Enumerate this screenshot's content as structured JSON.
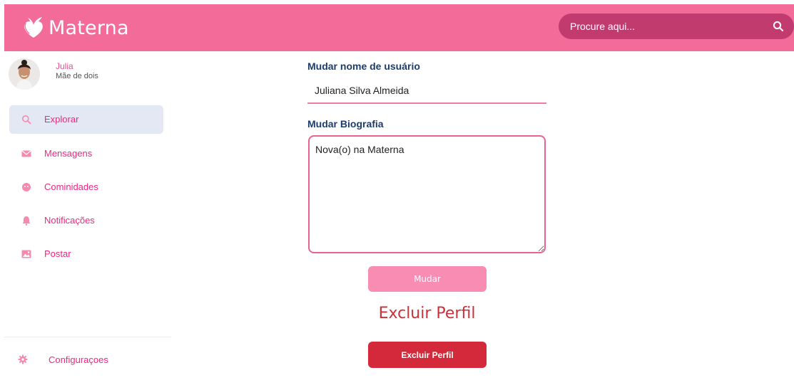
{
  "brand": {
    "name": "Materna",
    "logo_icon": "butterfly-heart-logo",
    "color": "#f26b99"
  },
  "search": {
    "placeholder": "Procure aqui...",
    "icon": "search-icon"
  },
  "profile": {
    "name": "Julia",
    "bio": "Mãe de dois"
  },
  "sidebar": {
    "items": [
      {
        "label": "Explorar",
        "icon": "search-icon",
        "active": true
      },
      {
        "label": "Mensagens",
        "icon": "envelope-icon",
        "active": false
      },
      {
        "label": "Cominidades",
        "icon": "community-icon",
        "active": false
      },
      {
        "label": "Notificações",
        "icon": "bell-icon",
        "active": false
      },
      {
        "label": "Postar",
        "icon": "image-icon",
        "active": false
      }
    ],
    "settings": {
      "label": "Configuraçoes",
      "icon": "gear-icon"
    }
  },
  "form": {
    "username_title": "Mudar nome de usuário",
    "username_value": "Juliana Silva Almeida",
    "bio_title": "Mudar Biografia",
    "bio_value": "Nova(o) na Materna",
    "submit_label": "Mudar",
    "delete_heading": "Excluir Perfil",
    "delete_label": "Excluir Perfil"
  },
  "colors": {
    "header": "#f26b99",
    "search_bg": "#c23b6f",
    "accent_text": "#f0267f",
    "title_text": "#1c3d6b",
    "delete": "#d4293a",
    "submit": "#f98cb2"
  }
}
